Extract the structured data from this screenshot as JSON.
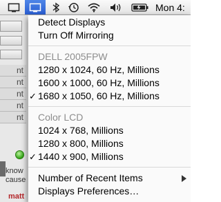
{
  "menubar": {
    "clock": "Mon 4:",
    "icons": [
      "display-icon",
      "bluetooth-icon",
      "time-machine-icon",
      "wifi-icon",
      "volume-icon",
      "battery-icon"
    ]
  },
  "background": {
    "cells": [
      "nt",
      "nt",
      "nt",
      "nt",
      "nt"
    ],
    "text_line1": "know",
    "text_line2": "cause",
    "red_text": "matt"
  },
  "menu": {
    "detect_displays": "Detect Displays",
    "turn_off_mirroring": "Turn Off Mirroring",
    "sections": [
      {
        "header": "DELL 2005FPW",
        "items": [
          {
            "label": "1280 x 1024, 60 Hz, Millions",
            "checked": false
          },
          {
            "label": "1600 x 1000, 60 Hz, Millions",
            "checked": false
          },
          {
            "label": "1680 x 1050, 60 Hz, Millions",
            "checked": true
          }
        ]
      },
      {
        "header": "Color LCD",
        "items": [
          {
            "label": "1024 x 768, Millions",
            "checked": false
          },
          {
            "label": "1280 x 800, Millions",
            "checked": false
          },
          {
            "label": "1440 x 900, Millions",
            "checked": true
          }
        ]
      }
    ],
    "recent_items": "Number of Recent Items",
    "preferences": "Displays Preferences…",
    "check_glyph": "✓"
  }
}
